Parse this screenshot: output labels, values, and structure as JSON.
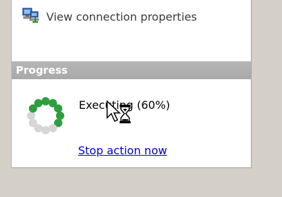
{
  "tasks": {
    "view_connection_properties": {
      "label": "View connection properties",
      "icon": "network-connection-icon"
    }
  },
  "progress": {
    "header": "Progress",
    "status_text": "Executing (60%)",
    "percent": 60,
    "stop_link": "Stop action now",
    "spinner_icon": "progress-spinner-icon",
    "cursor_icon": "busy-cursor-icon"
  },
  "colors": {
    "panel_background": "#ffffff",
    "frame": "#d4d0c8",
    "header_background": "#adadad",
    "header_text": "#ffffff",
    "link": "#0000cc",
    "spinner_active": "#2e9e3e",
    "spinner_inactive": "#d6d6d6"
  }
}
